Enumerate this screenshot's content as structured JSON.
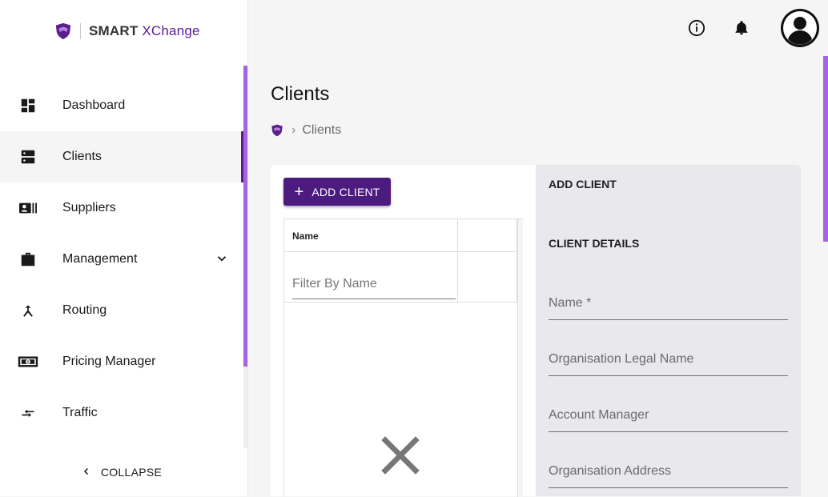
{
  "app": {
    "brand_bold": "SMART",
    "brand_light": "XChange"
  },
  "sidebar": {
    "items": [
      {
        "label": "Dashboard",
        "icon": "dashboard-icon"
      },
      {
        "label": "Clients",
        "icon": "clients-icon",
        "active": true
      },
      {
        "label": "Suppliers",
        "icon": "suppliers-icon"
      },
      {
        "label": "Management",
        "icon": "briefcase-icon"
      },
      {
        "label": "Routing",
        "icon": "routing-icon"
      },
      {
        "label": "Pricing Manager",
        "icon": "money-icon"
      },
      {
        "label": "Traffic",
        "icon": "traffic-icon"
      }
    ],
    "collapse_label": "COLLAPSE"
  },
  "header": {
    "icons": [
      "info-icon",
      "bell-icon",
      "avatar-icon"
    ]
  },
  "page": {
    "title": "Clients",
    "breadcrumb_sep": "›",
    "breadcrumb_current": "Clients"
  },
  "left_panel": {
    "add_button": "ADD CLIENT",
    "column_name": "Name",
    "filter_placeholder": "Filter By Name"
  },
  "right_panel": {
    "title": "ADD CLIENT",
    "section": "CLIENT DETAILS",
    "fields": [
      "Name *",
      "Organisation Legal Name",
      "Account Manager",
      "Organisation Address"
    ]
  },
  "colors": {
    "accent": "#4d1a7f",
    "scroll_accent": "#a665e0",
    "panel_bg": "#e8e8ed"
  }
}
